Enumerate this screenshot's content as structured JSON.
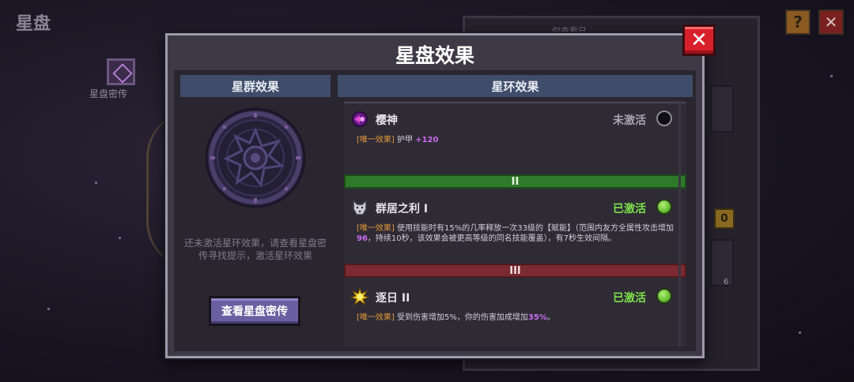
{
  "page": {
    "title": "星盘",
    "help_icon": "?",
    "close_icon": "✕",
    "side_nav_label": "星盘密传",
    "bg_tabs": [
      "",
      "仅查看已"
    ],
    "bg_coin": "0",
    "bg_count": "6"
  },
  "dialog": {
    "title": "星盘效果",
    "close_label": "✕",
    "left": {
      "header": "星群效果",
      "hint": "还未激活星环效果，请查看星盘密传寻找提示，激活星环效果",
      "lore_button": "查看星盘密传"
    },
    "right": {
      "header": "星环效果",
      "entries": [
        {
          "name": "樱神",
          "status": "未激活",
          "tag": "[唯一效果]",
          "desc_pre": "护甲 ",
          "desc_hl": "+120",
          "desc_post": "",
          "icon": "sakura-icon"
        },
        {
          "tier": "II",
          "name": "群居之利 I",
          "status": "已激活",
          "tag": "[唯一效果]",
          "desc_a": "使用技能时有15%的几率释放一次33级的【赋能】（范围内友方全属性攻击增加",
          "desc_hl1": "96",
          "desc_b": "，持续10秒，该效果会被更高等级的同名技能覆盖），有7秒生效间隔。",
          "icon": "wolf-icon"
        },
        {
          "tier": "III",
          "name": "逐日 II",
          "status": "已激活",
          "tag": "[唯一效果]",
          "desc_pre": "受到伤害增加5%，你的伤害加成增加",
          "desc_hl": "35%",
          "desc_post": "。",
          "icon": "sun-icon"
        }
      ]
    }
  },
  "colors": {
    "active": "#7ce04a",
    "inactive": "#a9a4b0",
    "tag": "#e09a3a",
    "highlight": "#c86cf0",
    "tier2": "#2f7a2a",
    "tier3": "#7a2a30",
    "close": "#d8202a"
  }
}
